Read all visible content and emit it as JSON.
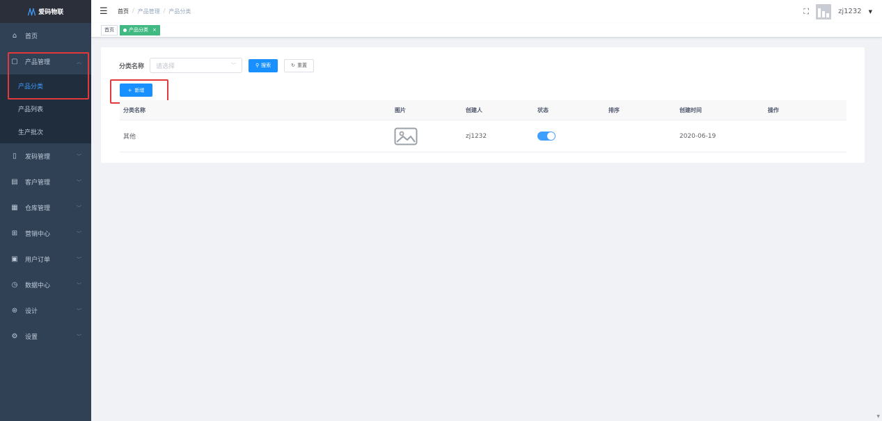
{
  "app": {
    "logo_text": "爱码物联",
    "logo_mark": "/\\/\\"
  },
  "sidebar": {
    "items": [
      {
        "label": "首页",
        "icon": "home-icon"
      },
      {
        "label": "产品管理",
        "icon": "box-icon",
        "expanded": true,
        "children": [
          {
            "label": "产品分类",
            "active": true
          },
          {
            "label": "产品列表"
          },
          {
            "label": "生产批次"
          }
        ]
      },
      {
        "label": "发码管理",
        "icon": "tablet-icon"
      },
      {
        "label": "客户管理",
        "icon": "building-icon"
      },
      {
        "label": "仓库管理",
        "icon": "grid-icon"
      },
      {
        "label": "营销中心",
        "icon": "gift-icon"
      },
      {
        "label": "用户订单",
        "icon": "clipboard-icon"
      },
      {
        "label": "数据中心",
        "icon": "pie-icon"
      },
      {
        "label": "设计",
        "icon": "palette-icon"
      },
      {
        "label": "设置",
        "icon": "settings-icon"
      }
    ]
  },
  "header": {
    "breadcrumb": [
      "首页",
      "产品管理",
      "产品分类"
    ],
    "separator": "/",
    "username": "zj1232"
  },
  "tags": [
    {
      "label": "首页",
      "active": false
    },
    {
      "label": "产品分类",
      "active": true
    }
  ],
  "filter": {
    "label": "分类名称",
    "placeholder": "请选择",
    "search_label": "搜索",
    "reset_label": "重置"
  },
  "add_button_label": "新增",
  "table": {
    "columns": [
      "分类名称",
      "图片",
      "创建人",
      "状态",
      "排序",
      "创建时间",
      "操作"
    ],
    "rows": [
      {
        "name": "其他",
        "creator": "zj1232",
        "status_on": true,
        "sort": "",
        "created": "2020-06-19",
        "actions": ""
      }
    ]
  },
  "colors": {
    "sidebar_bg": "#304156",
    "primary": "#1890ff",
    "tag_active": "#42b983",
    "highlight_box": "#e3393c"
  }
}
